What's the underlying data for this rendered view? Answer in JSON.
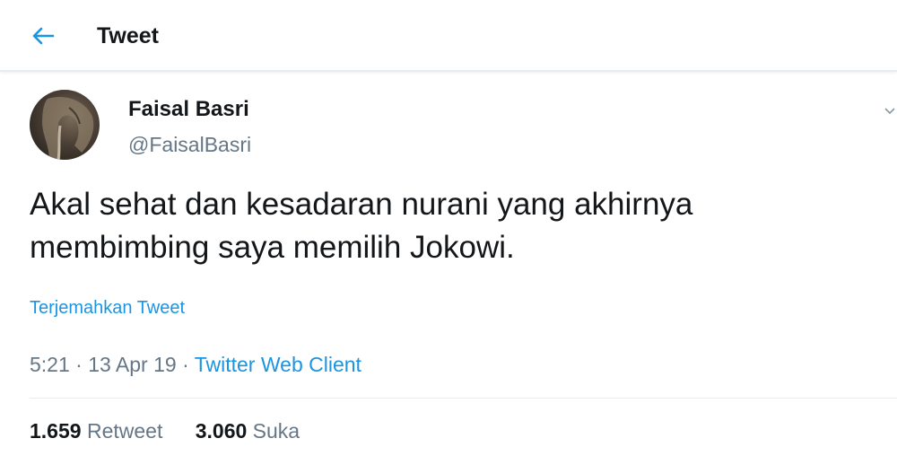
{
  "header": {
    "title": "Tweet",
    "back_icon": "arrow-left-icon",
    "accent_color": "#1b95e0"
  },
  "tweet": {
    "author_name": "Faisal Basri",
    "author_handle": "@FaisalBasri",
    "text_line1": "Akal sehat dan kesadaran nurani yang akhirnya",
    "text_line2": "membimbing saya memilih Jokowi.",
    "translate_label": "Terjemahkan Tweet",
    "time": "5:21",
    "date": "13 Apr 19",
    "separator": "·",
    "source": "Twitter Web Client",
    "more_icon": "chevron-down-icon"
  },
  "stats": {
    "retweet_count": "1.659",
    "retweet_label": "Retweet",
    "like_count": "3.060",
    "like_label": "Suka"
  }
}
